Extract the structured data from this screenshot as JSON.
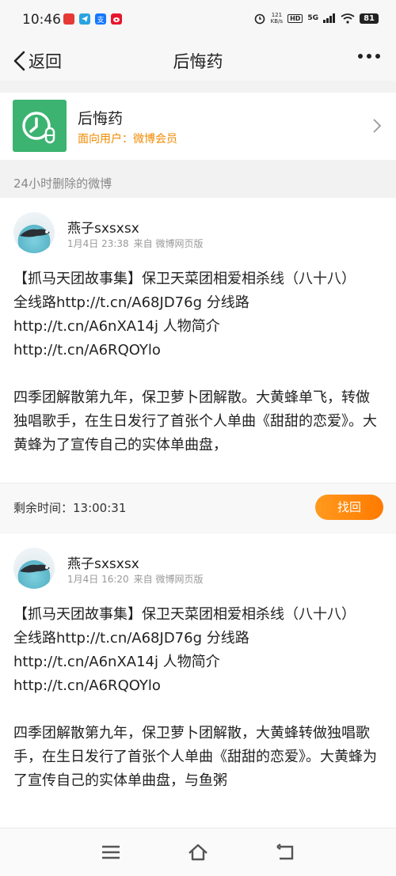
{
  "status_bar": {
    "time": "10:46",
    "app_icons": [
      "notification-app-icon",
      "telegram-icon",
      "alipay-icon",
      "weibo-icon"
    ],
    "app_labels": [
      "",
      "",
      "支",
      ""
    ],
    "net_speed_value": "121",
    "net_speed_unit": "KB/s",
    "hd_label": "HD",
    "network": "5G",
    "battery": "81"
  },
  "nav": {
    "back_label": "返回",
    "title": "后悔药"
  },
  "feature": {
    "name": "后悔药",
    "audience_label": "面向用户：微博会员",
    "logo_color": "#3cb371"
  },
  "section_label": "24小时删除的微博",
  "posts": [
    {
      "username": "燕子sxsxsx",
      "date": "1月4日 23:38",
      "source": "来自 微博网页版",
      "lines": [
        "【抓马天团故事集】保卫天菜团相爱相杀线（八十八）",
        "全线路http://t.cn/A68JD76g 分线路",
        "http://t.cn/A6nXA14j 人物简介",
        "http://t.cn/A6RQOYlo",
        "",
        "四季团解散第九年，保卫萝卜团解散。大黄蜂单飞，转做独唱歌手，在生日发行了首张个人单曲《甜甜的恋爱》。大黄蜂为了宣传自己的实体单曲盘，"
      ],
      "remaining_label": "剩余时间：13:00:31",
      "recover_label": "找回"
    },
    {
      "username": "燕子sxsxsx",
      "date": "1月4日 16:20",
      "source": "来自 微博网页版",
      "lines": [
        "【抓马天团故事集】保卫天菜团相爱相杀线（八十八）",
        "全线路http://t.cn/A68JD76g 分线路",
        "http://t.cn/A6nXA14j 人物简介",
        "http://t.cn/A6RQOYlo",
        "",
        "四季团解散第九年，保卫萝卜团解散，大黄蜂转做独唱歌手，在生日发行了首张个人单曲《甜甜的恋爱》。大黄蜂为了宣传自己的实体单曲盘，与鱼粥"
      ]
    }
  ],
  "colors": {
    "accent_orange": "#ff8a00",
    "audience_text": "#f08a00"
  }
}
